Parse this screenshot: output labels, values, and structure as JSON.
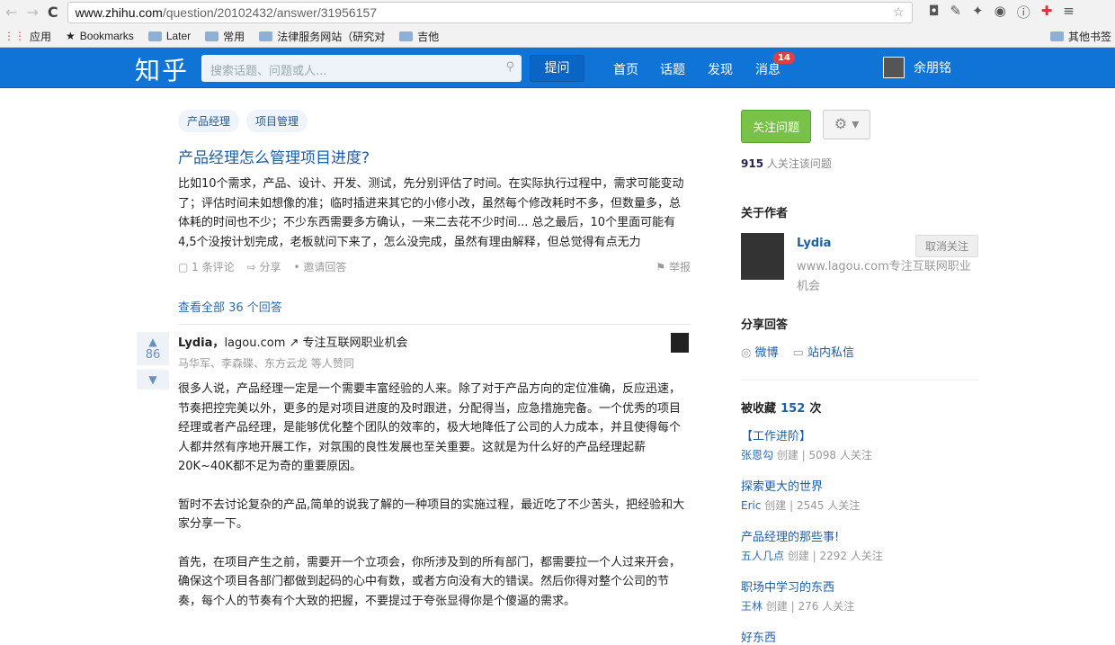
{
  "browser": {
    "url_host": "www.zhihu.com",
    "url_path": "/question/20102432/answer/31956157",
    "bookmarks": [
      "应用",
      "Bookmarks",
      "Later",
      "常用",
      "法律服务网站（研究对",
      "吉他"
    ],
    "other_bookmarks": "其他书签"
  },
  "topbar": {
    "logo": "知乎",
    "search_placeholder": "搜索话题、问题或人...",
    "ask": "提问",
    "nav": [
      "首页",
      "话题",
      "发现",
      "消息"
    ],
    "badge": "14",
    "username": "余朋铭"
  },
  "question": {
    "tags": [
      "产品经理",
      "项目管理"
    ],
    "title": "产品经理怎么管理项目进度?",
    "description": "比如10个需求，产品、设计、开发、测试，先分别评估了时间。在实际执行过程中，需求可能变动了；评估时间未如想像的准；临时插进来其它的小修小改，虽然每个修改耗时不多，但数量多，总体耗的时间也不少；不少东西需要多方确认，一来二去花不少时间... 总之最后，10个里面可能有4,5个没按计划完成，老板就问下来了，怎么没完成，虽然有理由解释，但总觉得有点无力",
    "comments": "1 条评论",
    "share": "分享",
    "invite": "邀请回答",
    "report": "举报",
    "view_all": "查看全部 36 个回答"
  },
  "answer": {
    "votes": "86",
    "author": "Lydia",
    "author_sep": "，",
    "author_desc": "lagou.com ↗ 专注互联网职业机会",
    "voters": "马华军、李森碟、东方云龙 等人赞同",
    "paragraphs": [
      "很多人说，产品经理一定是一个需要丰富经验的人来。除了对于产品方向的定位准确，反应迅速，节奏把控完美以外，更多的是对项目进度的及时跟进，分配得当，应急措施完备。一个优秀的项目经理或者产品经理，是能够优化整个团队的效率的，极大地降低了公司的人力成本，并且使得每个人都井然有序地开展工作，对氛围的良性发展也至关重要。这就是为什么好的产品经理起薪20K~40K都不足为奇的重要原因。",
      "暂时不去讨论复杂的产品,简单的说我了解的一种项目的实施过程，最近吃了不少苦头，把经验和大家分享一下。",
      "首先，在项目产生之前，需要开一个立项会，你所涉及到的所有部门，都需要拉一个人过来开会，确保这个项目各部门都做到起码的心中有数，或者方向没有大的错误。然后你得对整个公司的节奏，每个人的节奏有个大致的把握，不要提过于夸张显得你是个傻逼的需求。"
    ]
  },
  "sidebar": {
    "follow": "关注问题",
    "followers": "915",
    "followers_label": "人关注该问题",
    "about_author": "关于作者",
    "author_name": "Lydia",
    "author_bio": "www.lagou.com专注互联网职业机会",
    "unfollow": "取消关注",
    "share_title": "分享回答",
    "weibo": "微博",
    "pm": "站内私信",
    "collected_label": "被收藏",
    "collected": "152",
    "collected_unit": "次",
    "collections": [
      {
        "title": "【工作进阶】",
        "creator": "张恩勾",
        "followers": "5098 人关注"
      },
      {
        "title": "探索更大的世界",
        "creator": "Eric",
        "followers": "2545 人关注"
      },
      {
        "title": "产品经理的那些事!",
        "creator": "五人几点",
        "followers": "2292 人关注"
      },
      {
        "title": "职场中学习的东西",
        "creator": "王林",
        "followers": "276 人关注"
      }
    ],
    "created": "创建",
    "more": "好东西"
  }
}
